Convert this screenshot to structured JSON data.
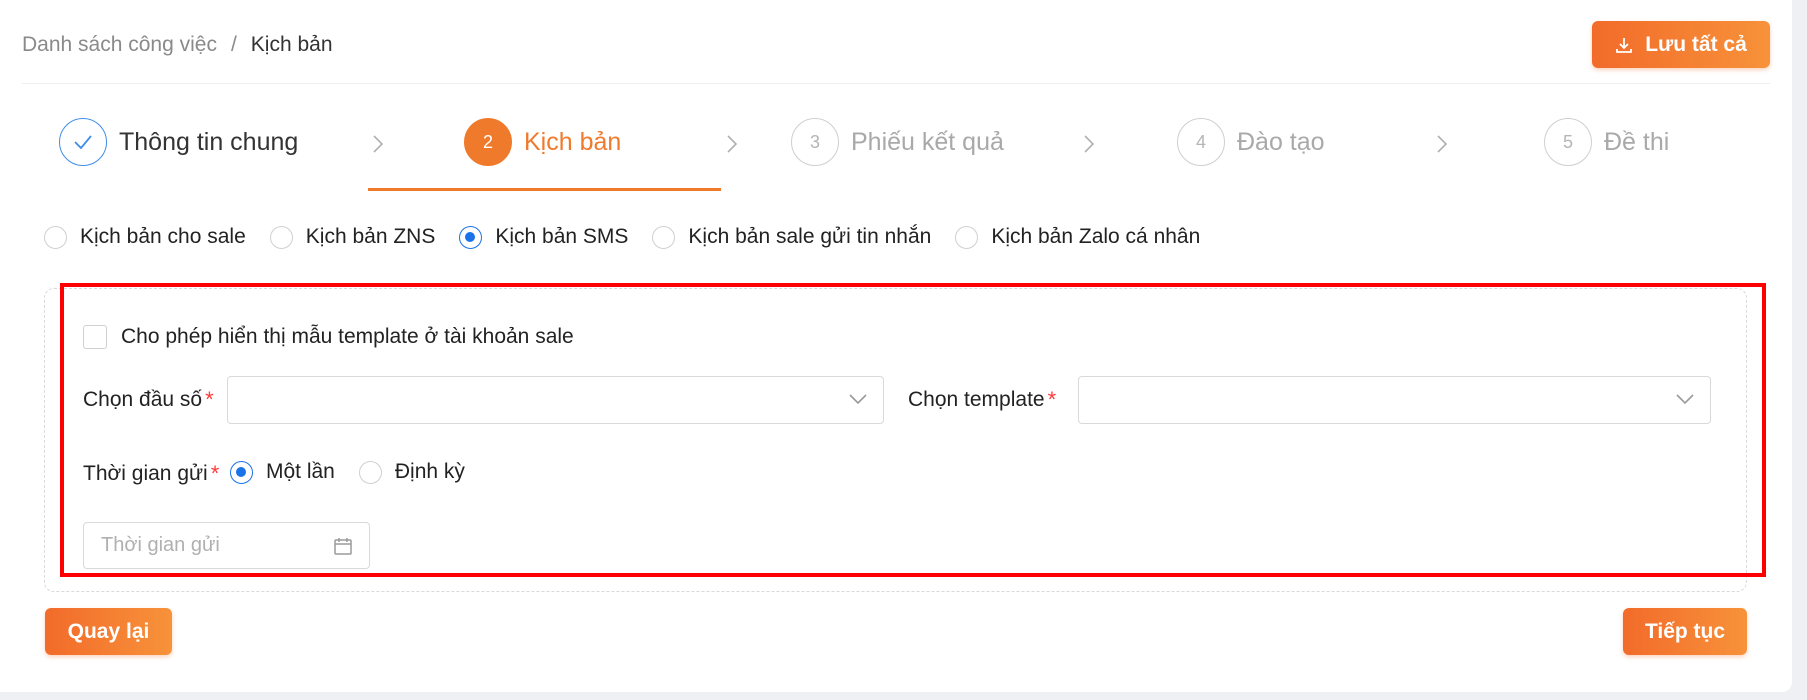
{
  "breadcrumb": {
    "parent": "Danh sách công việc",
    "separator": "/",
    "current": "Kịch bản"
  },
  "header": {
    "save_label": "Lưu tất cả"
  },
  "steps": [
    {
      "number": "",
      "label": "Thông tin chung",
      "status": "done"
    },
    {
      "number": "2",
      "label": "Kịch bản",
      "status": "active"
    },
    {
      "number": "3",
      "label": "Phiếu kết quả",
      "status": "pending"
    },
    {
      "number": "4",
      "label": "Đào tạo",
      "status": "pending"
    },
    {
      "number": "5",
      "label": "Đề thi",
      "status": "pending"
    }
  ],
  "script_types": [
    {
      "label": "Kịch bản cho sale",
      "checked": false
    },
    {
      "label": "Kịch bản ZNS",
      "checked": false
    },
    {
      "label": "Kịch bản SMS",
      "checked": true
    },
    {
      "label": "Kịch bản sale gửi tin nhắn",
      "checked": false
    },
    {
      "label": "Kịch bản Zalo cá nhân",
      "checked": false
    }
  ],
  "form": {
    "allow_template_label": "Cho phép hiển thị mẫu template ở tài khoản sale",
    "allow_template_checked": false,
    "prefix_label": "Chọn đầu số",
    "prefix_value": "",
    "template_label": "Chọn template",
    "template_value": "",
    "required_mark": "*",
    "send_time_label": "Thời gian gửi",
    "send_time_options": [
      {
        "label": "Một lần",
        "checked": true
      },
      {
        "label": "Định kỳ",
        "checked": false
      }
    ],
    "send_time_placeholder": "Thời gian gửi"
  },
  "footer": {
    "back_label": "Quay lại",
    "next_label": "Tiếp tục"
  },
  "colors": {
    "accent": "#f07a2c",
    "radio_checked": "#1a73e8",
    "required": "#ff3b3b",
    "highlight": "#ff0000"
  },
  "icons": {
    "save": "download-icon",
    "done_step": "check-icon",
    "separator": "chevron-right-icon",
    "select": "chevron-down-icon",
    "date": "calendar-icon"
  }
}
